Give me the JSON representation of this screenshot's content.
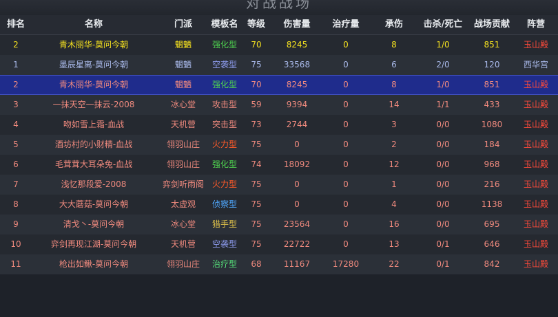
{
  "window_title": "对战战场",
  "headers": {
    "rank": "排名",
    "name": "名称",
    "school": "门派",
    "template": "模板名",
    "level": "等级",
    "damage": "伤害量",
    "heal": "治疗量",
    "tank": "承伤",
    "kd": "击杀/死亡",
    "contrib": "战场贡献",
    "camp": "阵营"
  },
  "colors": {
    "header_text": "#e9ecef",
    "self_row": "#f5e11f",
    "ally_blue": "#a9b9ea",
    "enemy_red": "#f08a7e",
    "selected_bg": "#1f2c8c",
    "template_strengthen": "#4fd44f",
    "template_assault": "#8e9cf0",
    "template_attack": "#f08a7e",
    "template_firepower": "#ff5a28",
    "template_recon": "#4fa8ff",
    "template_hunter": "#e0c24a",
    "template_heal": "#56e07a",
    "camp_yushan": "#ff4a3a",
    "camp_xihua": "#a9b9ea"
  },
  "rows": [
    {
      "rank": "2",
      "name": "青木丽华-莫问今朝",
      "school": "魍魉",
      "template": "强化型",
      "level": "70",
      "damage": "8245",
      "heal": "0",
      "tank": "8",
      "kd": "1/0",
      "contrib": "851",
      "camp": "玉山殿",
      "type": "self",
      "tpl_color": "#4fd44f",
      "camp_color": "#ff4a3a"
    },
    {
      "rank": "1",
      "name": "墨辰星离-莫问今朝",
      "school": "魍魉",
      "template": "空袭型",
      "level": "75",
      "damage": "33568",
      "heal": "0",
      "tank": "6",
      "kd": "2/0",
      "contrib": "120",
      "camp": "西华宫",
      "type": "ally",
      "tpl_color": "#8e9cf0",
      "camp_color": "#a9b9ea"
    },
    {
      "rank": "2",
      "name": "青木丽华-莫问今朝",
      "school": "魍魉",
      "template": "强化型",
      "level": "70",
      "damage": "8245",
      "heal": "0",
      "tank": "8",
      "kd": "1/0",
      "contrib": "851",
      "camp": "玉山殿",
      "type": "selected",
      "tpl_color": "#4fd44f",
      "camp_color": "#ff4a3a"
    },
    {
      "rank": "3",
      "name": "一抹天空一抹云-2008",
      "school": "冰心堂",
      "template": "攻击型",
      "level": "59",
      "damage": "9394",
      "heal": "0",
      "tank": "14",
      "kd": "1/1",
      "contrib": "433",
      "camp": "玉山殿",
      "type": "enemy",
      "tpl_color": "#f08a7e",
      "camp_color": "#ff4a3a"
    },
    {
      "rank": "4",
      "name": "吻如雪上霜-血战",
      "school": "天机营",
      "template": "突击型",
      "level": "73",
      "damage": "2744",
      "heal": "0",
      "tank": "3",
      "kd": "0/0",
      "contrib": "1080",
      "camp": "玉山殿",
      "type": "enemy",
      "tpl_color": "#f08a7e",
      "camp_color": "#ff4a3a"
    },
    {
      "rank": "5",
      "name": "酒坊村的小财精-血战",
      "school": "翎羽山庄",
      "template": "火力型",
      "level": "75",
      "damage": "0",
      "heal": "0",
      "tank": "2",
      "kd": "0/0",
      "contrib": "184",
      "camp": "玉山殿",
      "type": "enemy",
      "tpl_color": "#ff5a28",
      "camp_color": "#ff4a3a"
    },
    {
      "rank": "6",
      "name": "毛茸茸大耳朵兔-血战",
      "school": "翎羽山庄",
      "template": "强化型",
      "level": "74",
      "damage": "18092",
      "heal": "0",
      "tank": "12",
      "kd": "0/0",
      "contrib": "968",
      "camp": "玉山殿",
      "type": "enemy",
      "tpl_color": "#4fd44f",
      "camp_color": "#ff4a3a"
    },
    {
      "rank": "7",
      "name": "浅忆那段爱-2008",
      "school": "弈剑听雨阁",
      "template": "火力型",
      "level": "75",
      "damage": "0",
      "heal": "0",
      "tank": "1",
      "kd": "0/0",
      "contrib": "216",
      "camp": "玉山殿",
      "type": "enemy",
      "tpl_color": "#ff5a28",
      "camp_color": "#ff4a3a"
    },
    {
      "rank": "8",
      "name": "大大蘑菇-莫问今朝",
      "school": "太虚观",
      "template": "侦察型",
      "level": "75",
      "damage": "0",
      "heal": "0",
      "tank": "4",
      "kd": "0/0",
      "contrib": "1138",
      "camp": "玉山殿",
      "type": "enemy",
      "tpl_color": "#4fa8ff",
      "camp_color": "#ff4a3a"
    },
    {
      "rank": "9",
      "name": "清戈丶-莫问今朝",
      "school": "冰心堂",
      "template": "猎手型",
      "level": "75",
      "damage": "23564",
      "heal": "0",
      "tank": "16",
      "kd": "0/0",
      "contrib": "695",
      "camp": "玉山殿",
      "type": "enemy",
      "tpl_color": "#e0c24a",
      "camp_color": "#ff4a3a"
    },
    {
      "rank": "10",
      "name": "弈剑再现江湖-莫问今朝",
      "school": "天机营",
      "template": "空袭型",
      "level": "75",
      "damage": "22722",
      "heal": "0",
      "tank": "13",
      "kd": "0/1",
      "contrib": "646",
      "camp": "玉山殿",
      "type": "enemy",
      "tpl_color": "#8e9cf0",
      "camp_color": "#ff4a3a"
    },
    {
      "rank": "11",
      "name": "枪出如鳅-莫问今朝",
      "school": "翎羽山庄",
      "template": "治疗型",
      "level": "68",
      "damage": "11167",
      "heal": "17280",
      "tank": "22",
      "kd": "0/1",
      "contrib": "842",
      "camp": "玉山殿",
      "type": "enemy",
      "tpl_color": "#56e07a",
      "camp_color": "#ff4a3a"
    }
  ]
}
